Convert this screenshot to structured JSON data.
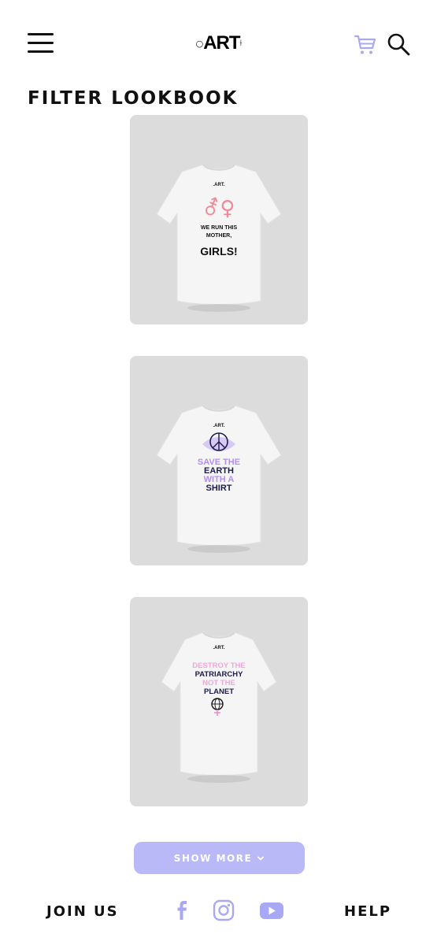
{
  "header": {
    "logo_prefix": "○",
    "logo_text": "ART",
    "logo_suffix": "⟊",
    "menu_icon": "hamburger-menu-icon",
    "cart_icon": "cart-icon",
    "search_icon": "search-icon"
  },
  "page": {
    "title": "FILTER LOOKBOOK"
  },
  "products": [
    {
      "brand": ".ART.",
      "symbol": "⚦♀",
      "lines": [
        "WE RUN THIS",
        "MOTHER,",
        "GIRLS!"
      ],
      "accent": "#f08a9a"
    },
    {
      "brand": ".ART.",
      "symbol": "☮",
      "lines": [
        "SAVE THE",
        "EARTH",
        "WITH A",
        "SHIRT"
      ],
      "accent": "#b28ef2"
    },
    {
      "brand": ".ART.",
      "symbol": "♀",
      "lines": [
        "DESTROY THE",
        "PATRIARCHY",
        "NOT THE",
        "PLANET"
      ],
      "accent": "#f0a8d8"
    }
  ],
  "show_more": {
    "label": "SHOW MORE",
    "chevron": "⌄"
  },
  "footer": {
    "join_label": "JOIN US",
    "help_label": "HELP",
    "social": [
      "facebook-icon",
      "instagram-icon",
      "youtube-icon"
    ]
  },
  "colors": {
    "accent": "#b9b9f7",
    "icon_accent": "#a8a8f5",
    "card_bg": "#dcdcdc"
  }
}
